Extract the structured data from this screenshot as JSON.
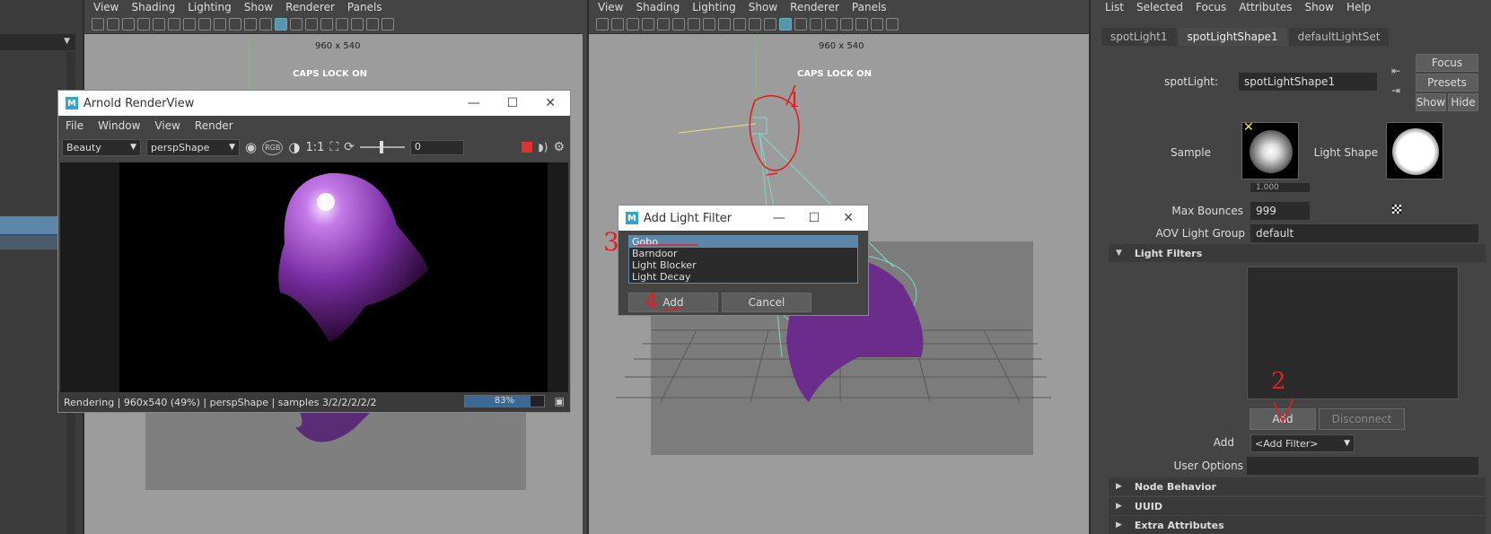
{
  "colors": {
    "viewport_bg": "#9c9c9c",
    "accent_blue": "#5d87aa",
    "annotation_red": "#e02020",
    "render_purple": "#9b3fd0"
  },
  "viewport_left": {
    "menus": [
      "View",
      "Shading",
      "Lighting",
      "Show",
      "Renderer",
      "Panels"
    ],
    "resolution": "960 x 540",
    "caps_lock": "CAPS LOCK ON"
  },
  "viewport_right": {
    "menus": [
      "View",
      "Shading",
      "Lighting",
      "Show",
      "Renderer",
      "Panels"
    ],
    "resolution": "960 x 540",
    "caps_lock": "CAPS LOCK ON"
  },
  "arnold": {
    "title": "Arnold RenderView",
    "menus": [
      "File",
      "Window",
      "View",
      "Render"
    ],
    "aov_select": "Beauty",
    "camera_select": "perspShape",
    "zoom_ratio": "1:1",
    "frame_value": "0",
    "status_text": "Rendering | 960x540 (49%) | perspShape  | samples 3/2/2/2/2/2",
    "progress_label": "83%",
    "progress_value": 0.83
  },
  "add_light_filter": {
    "title": "Add Light Filter",
    "items": [
      "Gobo",
      "Barndoor",
      "Light Blocker",
      "Light Decay"
    ],
    "selected_index": 0,
    "add_label": "Add",
    "cancel_label": "Cancel"
  },
  "attribute_editor": {
    "menus": [
      "List",
      "Selected",
      "Focus",
      "Attributes",
      "Show",
      "Help"
    ],
    "tabs": [
      "spotLight1",
      "spotLightShape1",
      "defaultLightSet"
    ],
    "active_tab": 1,
    "node_type_label": "spotLight:",
    "node_name": "spotLightShape1",
    "focus_label": "Focus",
    "presets_label": "Presets",
    "show_label": "Show",
    "hide_label": "Hide",
    "sample_label": "Sample",
    "light_shape_label": "Light Shape",
    "volume_partial": "1.000",
    "max_bounces_label": "Max Bounces",
    "max_bounces_value": "999",
    "aov_group_label": "AOV Light Group",
    "aov_group_value": "default",
    "light_filters_section": "Light Filters",
    "filter_add_button": "Add",
    "filter_disconnect_button": "Disconnect",
    "add_filter_label": "Add",
    "add_filter_value": "<Add Filter>",
    "user_options_label": "User Options",
    "sections": [
      "Node Behavior",
      "UUID",
      "Extra Attributes"
    ]
  },
  "annotations": [
    "1",
    "2",
    "3",
    "4"
  ],
  "icons": [
    "maya-logo-icon",
    "minimize-icon",
    "maximize-icon",
    "close-icon",
    "dropdown-arrow-icon",
    "stop-render-icon",
    "settings-gear-icon",
    "expand-triangle-icon",
    "collapse-triangle-icon"
  ]
}
